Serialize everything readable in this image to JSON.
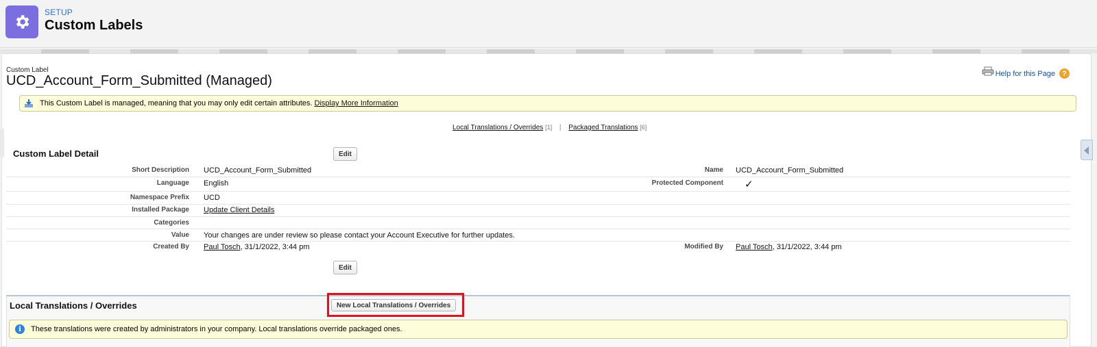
{
  "header": {
    "setup_label": "SETUP",
    "title": "Custom Labels",
    "icon": "gear-icon",
    "icon_bg": "#7b6fe0"
  },
  "page": {
    "breadcrumb": "Custom Label",
    "title": "UCD_Account_Form_Submitted (Managed)",
    "help_link": "Help for this Page",
    "help_icon": "?"
  },
  "notice": {
    "text": "This Custom Label is managed, meaning that you may only edit certain attributes.",
    "link": "Display More Information"
  },
  "related_links": [
    {
      "label": "Local Translations / Overrides",
      "count": "[1]"
    },
    {
      "label": "Packaged Translations",
      "count": "[6]"
    }
  ],
  "related_separator": "|",
  "detail": {
    "title": "Custom Label Detail",
    "edit_label": "Edit",
    "fields": {
      "short_description": {
        "label": "Short Description",
        "value": "UCD_Account_Form_Submitted"
      },
      "name": {
        "label": "Name",
        "value": "UCD_Account_Form_Submitted"
      },
      "language": {
        "label": "Language",
        "value": "English"
      },
      "protected_component": {
        "label": "Protected Component",
        "value": "✓"
      },
      "namespace_prefix": {
        "label": "Namespace Prefix",
        "value": "UCD"
      },
      "installed_package": {
        "label": "Installed Package",
        "value": "Update Client Details"
      },
      "categories": {
        "label": "Categories",
        "value": ""
      },
      "value": {
        "label": "Value",
        "value": "Your changes are under review so please contact your Account Executive for further updates."
      },
      "created_by": {
        "label": "Created By",
        "user": "Paul Tosch",
        "date": ", 31/1/2022, 3:44 pm"
      },
      "modified_by": {
        "label": "Modified By",
        "user": "Paul Tosch",
        "date": ", 31/1/2022, 3:44 pm"
      }
    }
  },
  "local_translations": {
    "title": "Local Translations / Overrides",
    "new_button": "New Local Translations / Overrides",
    "info": "These translations were created by administrators in your company. Local translations override packaged ones.",
    "highlight_color": "#e2121b"
  }
}
